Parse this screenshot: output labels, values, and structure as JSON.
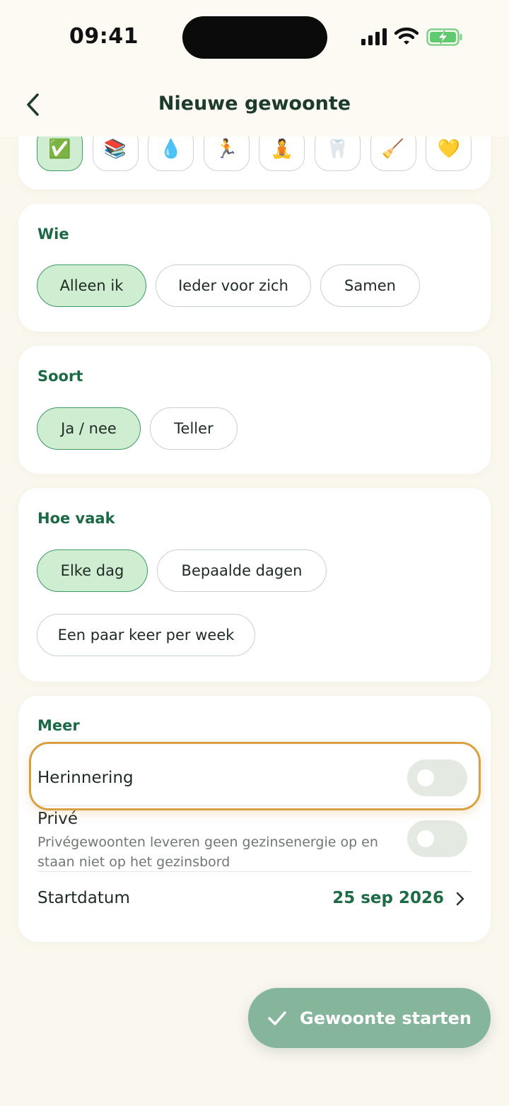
{
  "status": {
    "time": "09:41"
  },
  "header": {
    "title": "Nieuwe gewoonte",
    "back_icon": "chevron-left-icon"
  },
  "icons": {
    "items": [
      {
        "emoji": "✅",
        "name": "check-emoji",
        "selected": true
      },
      {
        "emoji": "📚",
        "name": "books-emoji",
        "selected": false
      },
      {
        "emoji": "💧",
        "name": "droplet-emoji",
        "selected": false
      },
      {
        "emoji": "🏃",
        "name": "runner-emoji",
        "selected": false
      },
      {
        "emoji": "🧘",
        "name": "meditation-emoji",
        "selected": false
      },
      {
        "emoji": "🦷",
        "name": "tooth-emoji",
        "selected": false
      },
      {
        "emoji": "🧹",
        "name": "broom-emoji",
        "selected": false
      },
      {
        "emoji": "💛",
        "name": "yellow-heart-emoji",
        "selected": false
      }
    ]
  },
  "wie": {
    "label": "Wie",
    "options": [
      {
        "label": "Alleen ik",
        "selected": true
      },
      {
        "label": "Ieder voor zich",
        "selected": false
      },
      {
        "label": "Samen",
        "selected": false
      }
    ]
  },
  "soort": {
    "label": "Soort",
    "options": [
      {
        "label": "Ja / nee",
        "selected": true
      },
      {
        "label": "Teller",
        "selected": false
      }
    ]
  },
  "hoe_vaak": {
    "label": "Hoe vaak",
    "options": [
      {
        "label": "Elke dag",
        "selected": true
      },
      {
        "label": "Bepaalde dagen",
        "selected": false
      },
      {
        "label": "Een paar keer per week",
        "selected": false
      }
    ]
  },
  "meer": {
    "label": "Meer",
    "herinnering": {
      "label": "Herinnering",
      "on": false
    },
    "prive": {
      "label": "Privé",
      "description": "Privégewoonten leveren geen gezinsenergie op en staan niet op het gezinsbord",
      "on": false
    },
    "startdatum": {
      "label": "Startdatum",
      "value": "25 sep 2026"
    }
  },
  "cta": {
    "label": "Gewoonte starten"
  },
  "colors": {
    "accent": "#1c6a45",
    "selected_bg": "#cfeed1",
    "cta_bg": "#85b59b",
    "highlight": "#d9a043",
    "background": "#faf7ee"
  }
}
